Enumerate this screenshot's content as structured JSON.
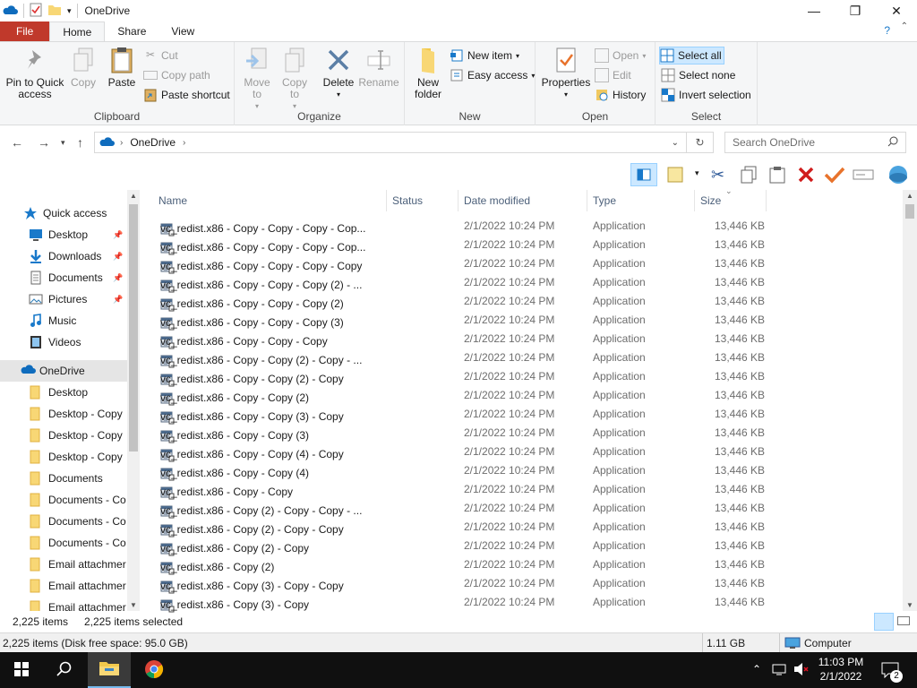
{
  "window": {
    "title": "OneDrive"
  },
  "ribbon_tabs": [
    "File",
    "Home",
    "Share",
    "View"
  ],
  "clipboard": {
    "group": "Clipboard",
    "pin_label": "Pin to Quick access",
    "copy_label": "Copy",
    "paste_label": "Paste",
    "cut_label": "Cut",
    "copy_path_label": "Copy path",
    "paste_shortcut_label": "Paste shortcut"
  },
  "organize": {
    "group": "Organize",
    "move_to": "Move to",
    "copy_to": "Copy to",
    "delete": "Delete",
    "rename": "Rename"
  },
  "new": {
    "group": "New",
    "new_folder": "New folder",
    "new_item": "New item",
    "easy_access": "Easy access"
  },
  "open": {
    "group": "Open",
    "properties": "Properties",
    "open": "Open",
    "edit": "Edit",
    "history": "History"
  },
  "select": {
    "group": "Select",
    "select_all": "Select all",
    "select_none": "Select none",
    "invert": "Invert selection"
  },
  "address": {
    "path": "OneDrive",
    "search_placeholder": "Search OneDrive"
  },
  "nav": {
    "quick_access": "Quick access",
    "quick_items": [
      "Desktop",
      "Downloads",
      "Documents",
      "Pictures",
      "Music",
      "Videos"
    ],
    "onedrive": "OneDrive",
    "onedrive_items": [
      "Desktop",
      "Desktop - Copy",
      "Desktop - Copy",
      "Desktop - Copy",
      "Documents",
      "Documents - Co",
      "Documents - Co",
      "Documents - Co",
      "Email attachmer",
      "Email attachmer",
      "Email attachmer"
    ]
  },
  "columns": {
    "name": "Name",
    "status": "Status",
    "date": "Date modified",
    "type": "Type",
    "size": "Size"
  },
  "files": {
    "date": "2/1/2022 10:24 PM",
    "type": "Application",
    "size": "13,446 KB",
    "names": [
      "vc_redist.x86 - Copy - Copy - Copy - Cop...",
      "vc_redist.x86 - Copy - Copy - Copy - Cop...",
      "vc_redist.x86 - Copy - Copy - Copy - Copy",
      "vc_redist.x86 - Copy - Copy - Copy (2) - ...",
      "vc_redist.x86 - Copy - Copy - Copy (2)",
      "vc_redist.x86 - Copy - Copy - Copy (3)",
      "vc_redist.x86 - Copy - Copy - Copy",
      "vc_redist.x86 - Copy - Copy (2) - Copy - ...",
      "vc_redist.x86 - Copy - Copy (2) - Copy",
      "vc_redist.x86 - Copy - Copy (2)",
      "vc_redist.x86 - Copy - Copy (3) - Copy",
      "vc_redist.x86 - Copy - Copy (3)",
      "vc_redist.x86 - Copy - Copy (4) - Copy",
      "vc_redist.x86 - Copy - Copy (4)",
      "vc_redist.x86 - Copy - Copy",
      "vc_redist.x86 - Copy (2) - Copy - Copy - ...",
      "vc_redist.x86 - Copy (2) - Copy - Copy",
      "vc_redist.x86 - Copy (2) - Copy",
      "vc_redist.x86 - Copy (2)",
      "vc_redist.x86 - Copy (3) - Copy - Copy",
      "vc_redist.x86 - Copy (3) - Copy"
    ]
  },
  "status": {
    "items": "2,225 items",
    "selected": "2,225 items selected"
  },
  "status_bar": {
    "disk": "2,225 items (Disk free space: 95.0 GB)",
    "size": "1.11 GB",
    "location": "Computer"
  },
  "taskbar": {
    "time": "11:03 PM",
    "date": "2/1/2022",
    "notifications": "2"
  },
  "colors": {
    "accent": "#1979ca",
    "file_tab": "#c0392b",
    "taskbar": "#101010",
    "select_all_bg": "#cce8ff"
  }
}
